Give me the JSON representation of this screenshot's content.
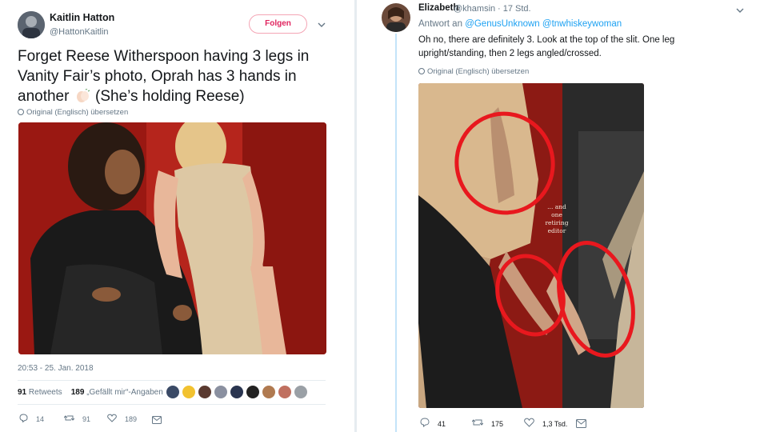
{
  "left_tweet": {
    "author_name": "Kaitlin Hatton",
    "author_handle": "@HattonKaitlin",
    "follow_label": "Folgen",
    "text_main": "Forget Reese Witherspoon having 3 legs in Vanity Fair’s photo, Oprah has 3 hands in another",
    "text_paren": "(She’s holding Reese)",
    "translate_label": "Original (Englisch) übersetzen",
    "timestamp": "20:53 - 25. Jan. 2018",
    "retweets_count": "91",
    "retweets_label": "Retweets",
    "likes_count": "189",
    "likes_label": "„Gefällt mir“-Angaben",
    "actions": {
      "replies": "14",
      "retweets": "91",
      "likes": "189"
    }
  },
  "right_tweet": {
    "author_name": "Elizabeth",
    "author_handle": "@khamsin",
    "time_ago": "· 17 Std.",
    "reply_prefix": "Antwort an",
    "mention_1": "@GenusUnknown",
    "mention_2": "@tnwhiskeywoman",
    "text": "Oh no, there are definitely 3. Look at the top of the slit. One leg upright/standing, then 2 legs angled/crossed.",
    "translate_label": "Original (Englisch) übersetzen",
    "image_caption_lines": [
      "... and",
      "one",
      "retiring",
      "editor"
    ],
    "actions": {
      "replies": "41",
      "retweets": "175",
      "likes": "1,3 Tsd."
    }
  },
  "colors": {
    "accent_blue": "#1da1f2",
    "follow_pink": "#e0245e",
    "muted": "#657786",
    "highlight_red": "#e8181e"
  },
  "icons": [
    "chevron-down-icon",
    "globe-icon",
    "reply-icon",
    "retweet-icon",
    "heart-icon",
    "message-icon",
    "clap-hands-icon"
  ]
}
